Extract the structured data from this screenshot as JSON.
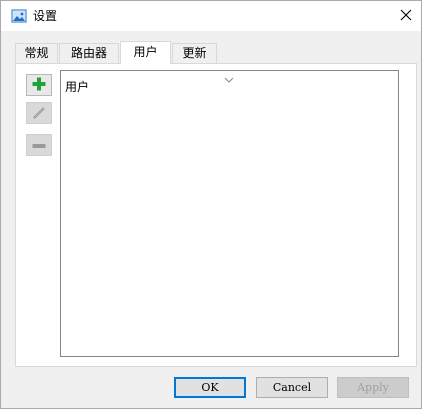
{
  "window": {
    "title": "设置",
    "icon": "picture-icon",
    "close_icon": "close-icon"
  },
  "tabs": [
    {
      "label": "常规",
      "active": false
    },
    {
      "label": "路由器",
      "active": false
    },
    {
      "label": "用户",
      "active": true
    },
    {
      "label": "更新",
      "active": false
    }
  ],
  "toolbar": {
    "add_icon": "plus-icon",
    "edit_icon": "pencil-icon",
    "remove_icon": "minus-icon"
  },
  "list": {
    "column_header": "用户",
    "rows": []
  },
  "buttons": {
    "ok": "OK",
    "cancel": "Cancel",
    "apply": "Apply"
  },
  "colors": {
    "accent": "#0078d7",
    "add_green": "#22a33a",
    "disabled_gray": "#a0a0a0"
  }
}
